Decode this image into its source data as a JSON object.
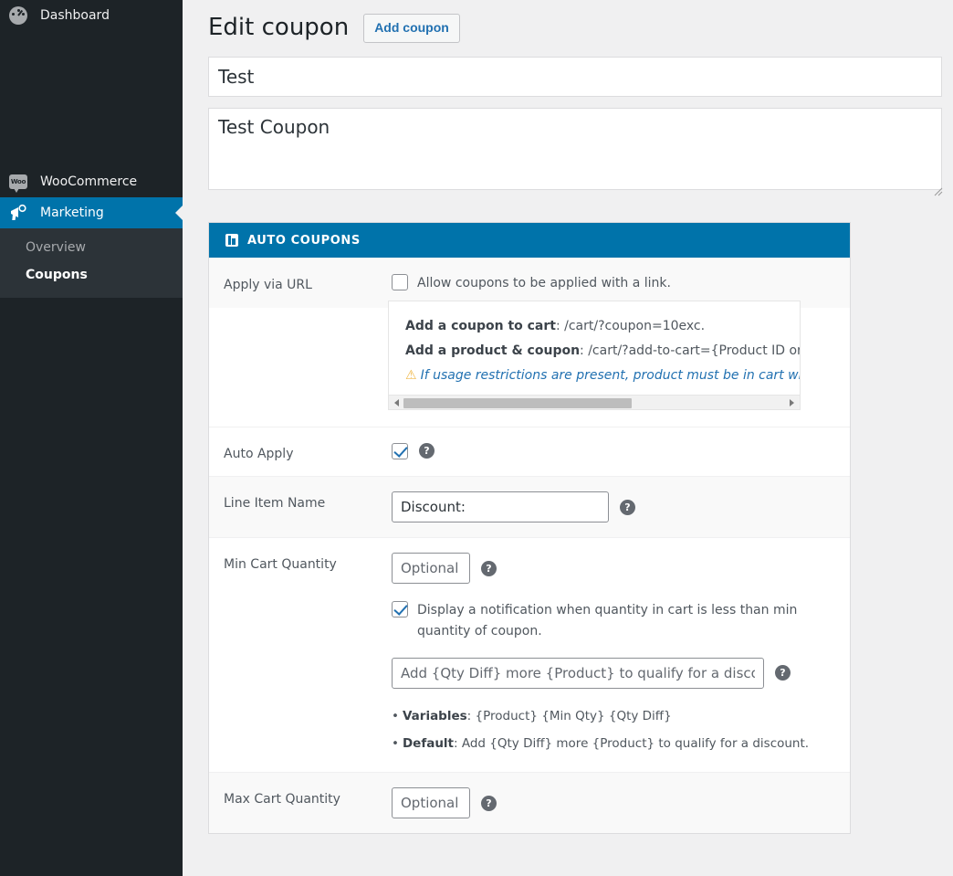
{
  "sidebar": {
    "top_item": {
      "label": "Dashboard",
      "icon": "gauge-icon"
    },
    "woocommerce": {
      "label": "WooCommerce",
      "icon": "woo-icon"
    },
    "marketing": {
      "label": "Marketing",
      "icon": "megaphone-icon"
    },
    "submenu": [
      {
        "label": "Overview",
        "current": false
      },
      {
        "label": "Coupons",
        "current": true
      }
    ]
  },
  "header": {
    "title": "Edit coupon",
    "add_button": "Add coupon"
  },
  "fields": {
    "title_value": "Test",
    "excerpt_value": "Test Coupon"
  },
  "panel": {
    "heading": "AUTO COUPONS",
    "rows": {
      "apply_via_url": {
        "label": "Apply via URL",
        "checkbox_label": "Allow coupons to be applied with a link.",
        "checked": false,
        "info": {
          "line1_label": "Add a coupon to cart",
          "line1_value": ": /cart/?coupon=10exc.",
          "line2_label": "Add a product & coupon",
          "line2_value": ": /cart/?add-to-cart={Product ID or Va",
          "note": "If usage restrictions are present, product must be in cart when link is",
          "warn_icon": "warning-triangle-icon"
        }
      },
      "auto_apply": {
        "label": "Auto Apply",
        "checked": true,
        "help_icon": "help-icon"
      },
      "line_item_name": {
        "label": "Line Item Name",
        "value": "Discount:",
        "help_icon": "help-icon"
      },
      "min_cart_quantity": {
        "label": "Min Cart Quantity",
        "placeholder": "Optional",
        "value": "",
        "help_icon": "help-icon",
        "notify_checkbox_label": "Display a notification when quantity in cart is less than min quantity of coupon.",
        "notify_checked": true,
        "message_placeholder": "Add {Qty Diff} more {Product} to qualify for a discou",
        "message_value": "",
        "variables_label": "Variables",
        "variables_value": ": {Product} {Min Qty} {Qty Diff}",
        "default_label": "Default",
        "default_value": ": Add {Qty Diff} more {Product} to qualify for a discount."
      },
      "max_cart_quantity": {
        "label": "Max Cart Quantity",
        "placeholder": "Optional",
        "value": "",
        "help_icon": "help-icon"
      }
    }
  },
  "colors": {
    "accent": "#0073aa",
    "link": "#2271b1",
    "sidebar_bg": "#1d2327",
    "submenu_bg": "#2c3338",
    "page_bg": "#f0f0f1",
    "warning": "#f0b849"
  }
}
